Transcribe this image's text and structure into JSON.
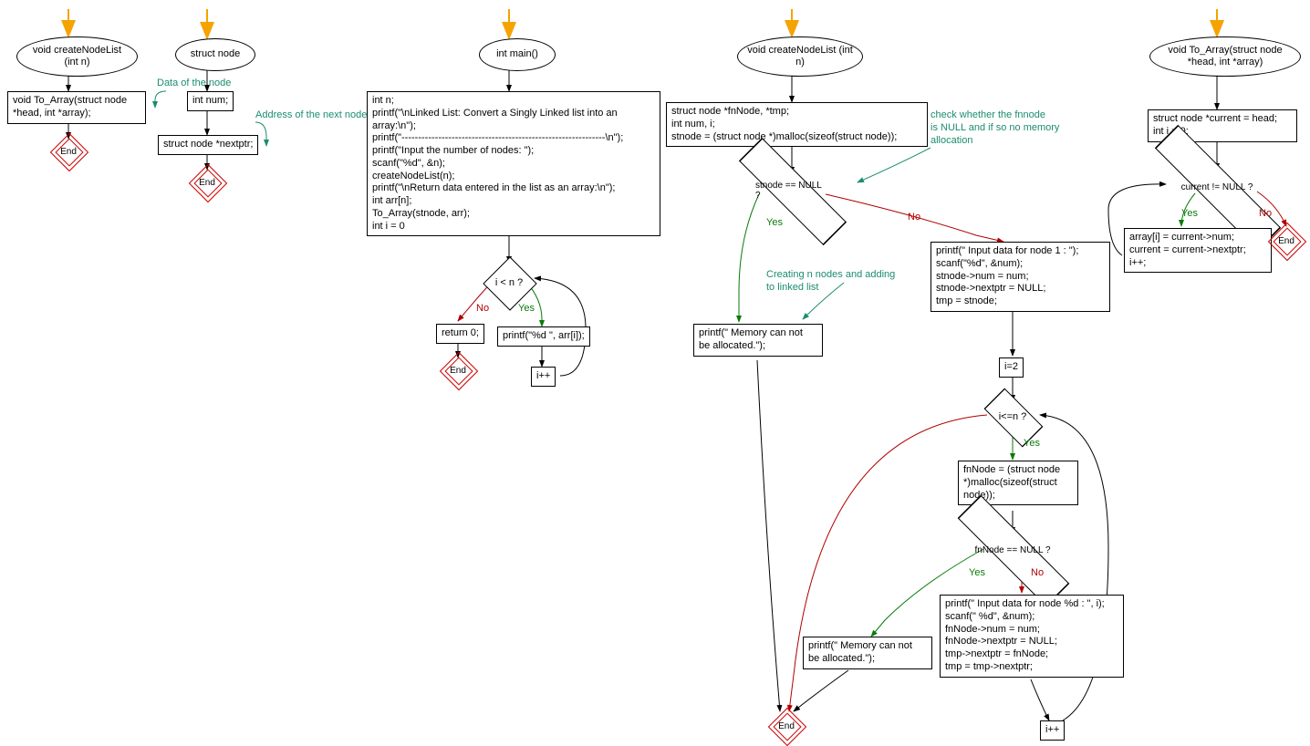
{
  "fc1": {
    "oval": "void createNodeList\n(int n)",
    "box": "void To_Array(struct node\n*head, int *array);"
  },
  "fc2": {
    "oval": "struct node",
    "box1": "int num;",
    "box2": "struct node *nextptr;",
    "ann1": "Data of the node",
    "ann2": "Address of the next node"
  },
  "fc3": {
    "oval": "int main()",
    "box1": "int n;\nprintf(\"\\nLinked List: Convert a Singly Linked list into an array:\\n\");\nprintf(\"-------------------------------------------------------------\\n\");\nprintf(\"Input the number of nodes: \");\nscanf(\"%d\", &n);\ncreateNodeList(n);\nprintf(\"\\nReturn data entered in the list as an array:\\n\");\nint arr[n];\nTo_Array(stnode, arr);\nint i = 0",
    "cond": "i < n ?",
    "ret": "return 0;",
    "print": "printf(\"%d \", arr[i]);",
    "inc": "i++"
  },
  "fc4": {
    "oval": "void createNodeList\n(int n)",
    "box1": "struct node *fnNode, *tmp;\nint num, i;\nstnode = (struct node *)malloc(sizeof(struct node));",
    "cond1": "stnode == NULL ?",
    "ann1": "check whether the fnnode\nis NULL and if so no memory\nallocation",
    "memErr1": "printf(\" Memory can not\nbe allocated.\");",
    "ann2": "Creating n nodes and adding\nto linked list",
    "box2": "printf(\" Input data for node 1 : \");\nscanf(\"%d\", &num);\nstnode->num = num;\nstnode->nextptr = NULL;\ntmp = stnode;",
    "box3": "i=2",
    "cond2": "i<=n ?",
    "box4": "fnNode = (struct node\n*)malloc(sizeof(struct\nnode));",
    "cond3": "fnNode == NULL ?",
    "memErr2": "printf(\" Memory can not\nbe allocated.\");",
    "box5": "printf(\" Input data for node %d : \", i);\nscanf(\" %d\", &num);\nfnNode->num = num;\nfnNode->nextptr = NULL;\ntmp->nextptr = fnNode;\ntmp = tmp->nextptr;",
    "inc": "i++"
  },
  "fc5": {
    "oval": "void To_Array(struct node\n*head, int *array)",
    "box1": "struct node *current = head;\nint i = 0;",
    "cond": "current != NULL ?",
    "box2": "array[i] = current->num;\ncurrent = current->nextptr;\ni++;"
  },
  "labels": {
    "yes": "Yes",
    "no": "No",
    "end": "End"
  },
  "chart_data": {
    "type": "flowchart",
    "flowcharts": 5,
    "description": "C program flowcharts: declarations, struct definition, main() driving loop, createNodeList(n) building a singly linked list with malloc+input loop, and To_Array converting the list into an array via traversal."
  }
}
